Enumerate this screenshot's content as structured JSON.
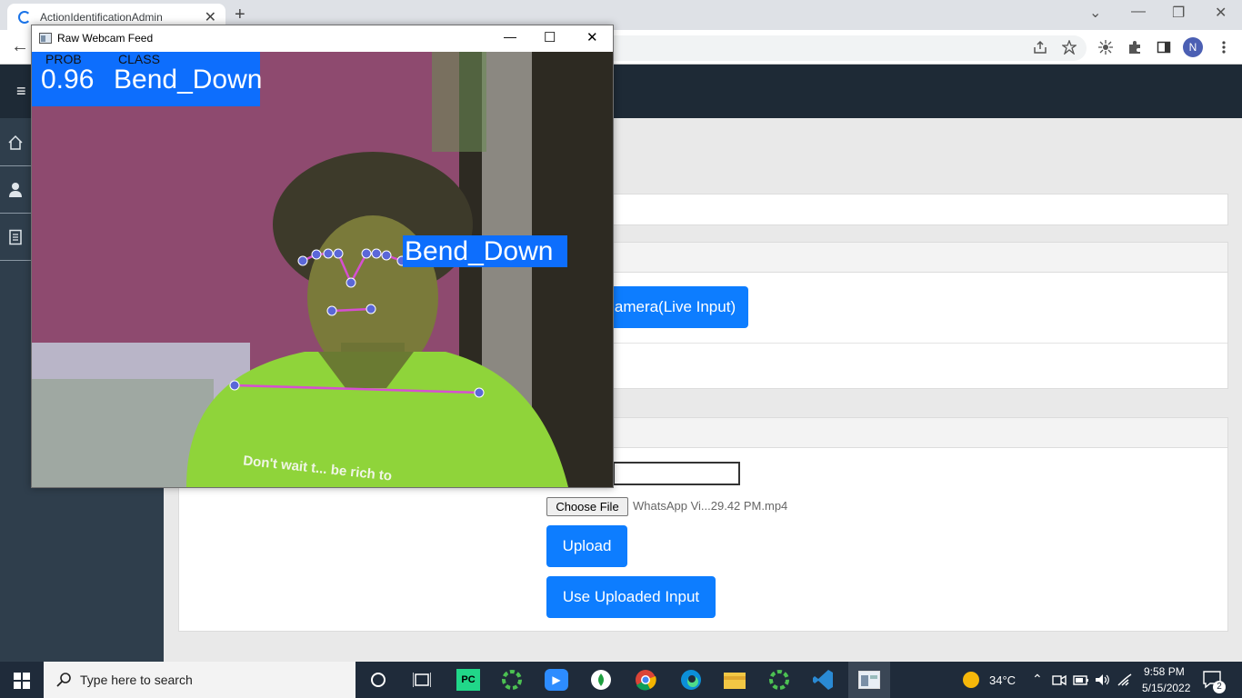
{
  "browser": {
    "tab_title": "ActionIdentificationAdmin",
    "tab_close": "✕",
    "new_tab": "+",
    "window_controls": [
      "⌄",
      "—",
      "❐",
      "✕"
    ],
    "back": "←",
    "profile_initial": "N",
    "toolbar_icons": [
      "share-icon",
      "star-icon",
      "extension-bug-icon",
      "puzzle-icon",
      "sidepanel-icon",
      "menu-icon"
    ]
  },
  "sidebar": {
    "menu": "≡",
    "items": [
      {
        "icon": "home-icon",
        "glyph": "⌂"
      },
      {
        "icon": "user-icon",
        "glyph": "👤"
      },
      {
        "icon": "document-icon",
        "glyph": "▤"
      }
    ]
  },
  "main": {
    "camera_button": "amera(Live Input)",
    "choose_file": "Choose File",
    "file_name": "WhatsApp Vi...29.42 PM.mp4",
    "upload_button": "Upload",
    "use_uploaded_button": "Use Uploaded Input"
  },
  "webcam_window": {
    "title": "Raw Webcam Feed",
    "controls": [
      "—",
      "☐",
      "✕"
    ],
    "prob_label": "PROB",
    "class_label": "CLASS",
    "prob_value": "0.96",
    "class_value": "Bend_Down",
    "pose_label": "Bend_Down",
    "shirt_text": "Don't wait t... be rich to",
    "accent_color": "#0d6efd",
    "landmark_color": "#d64fd1"
  },
  "taskbar": {
    "search_placeholder": "Type here to search",
    "apps": [
      "task-view-icon",
      "pycharm-icon",
      "chrome-like-icon",
      "zoom-icon",
      "notes-icon",
      "chrome-icon",
      "edge-icon",
      "file-explorer-icon",
      "spinner-app-icon",
      "vscode-icon",
      "window-app-icon"
    ],
    "weather": "34°C",
    "time": "9:58 PM",
    "date": "5/15/2022",
    "notifications": "2"
  }
}
